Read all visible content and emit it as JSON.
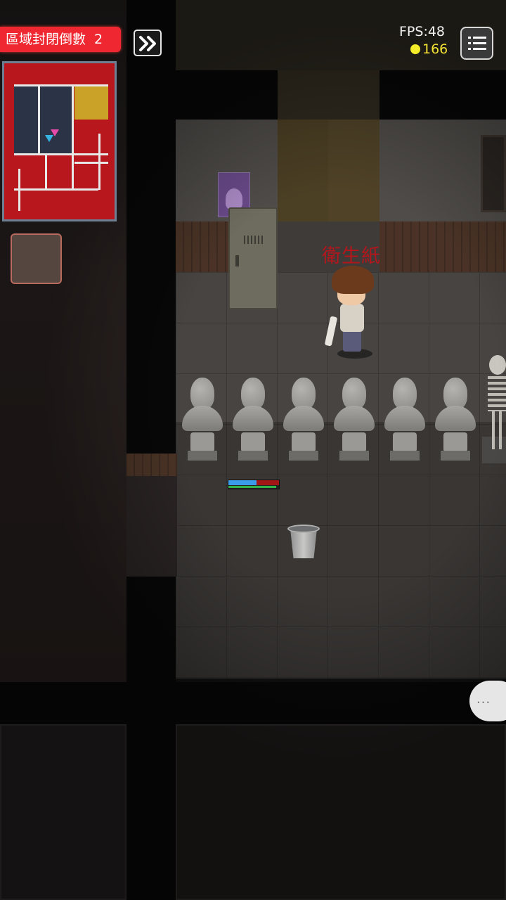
{
  "hud": {
    "countdown_label": "區域封閉倒數",
    "countdown_value": "2",
    "fps_text": "FPS:48",
    "coins": "166",
    "chat_text": "..."
  },
  "world": {
    "item_label": "衛生紙"
  },
  "player_status": {
    "health_fraction": 0.55,
    "stamina_fraction": 0.95
  },
  "icons": {
    "skip": "double-chevron-right-icon",
    "menu": "list-menu-icon",
    "coin": "coin-icon"
  },
  "colors": {
    "countdown_bg": "#ee2730",
    "coin": "#f4ec2a",
    "item_label": "#b4161c",
    "minimap_bg": "#b8171d"
  }
}
